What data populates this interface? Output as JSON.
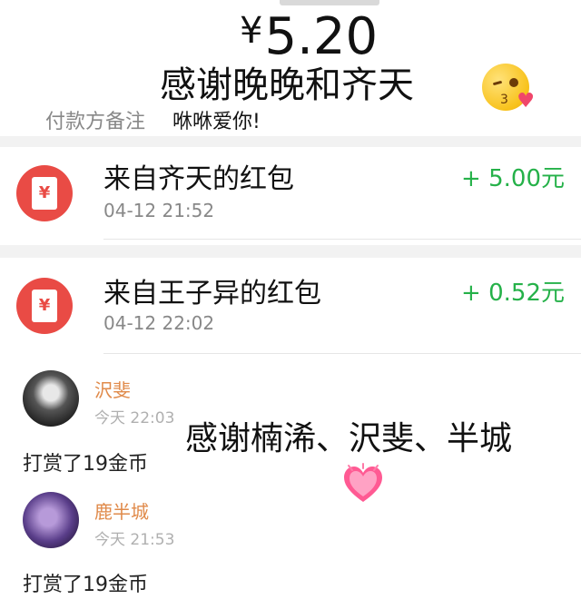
{
  "payment": {
    "currency": "¥",
    "amount": "5.20",
    "overlay_text": "感谢晚晚和齐天",
    "emoji": "kissing-face-with-heart",
    "remark_label": "付款方备注",
    "remark_value": "咻咻爱你!"
  },
  "red_packets": [
    {
      "title": "来自齐天的红包",
      "time": "04-12 21:52",
      "amount": "+ 5.00元",
      "icon": "yen-red-envelope-icon"
    },
    {
      "title": "来自王子异的红包",
      "time": "04-12 22:02",
      "amount": "+ 0.52元",
      "icon": "yen-red-envelope-icon"
    }
  ],
  "rewards": [
    {
      "name": "沢斐",
      "time": "今天 22:03",
      "action": "打赏了19金币"
    },
    {
      "name": "鹿半城",
      "time": "今天 21:53",
      "action": "打赏了19金币"
    }
  ],
  "overlay_thanks": "感谢楠浠、沢斐、半城",
  "colors": {
    "income_green": "#25b149",
    "red_packet_red": "#e94b45",
    "name_orange": "#e08a4a",
    "heart_pink": "#ff5a93"
  }
}
